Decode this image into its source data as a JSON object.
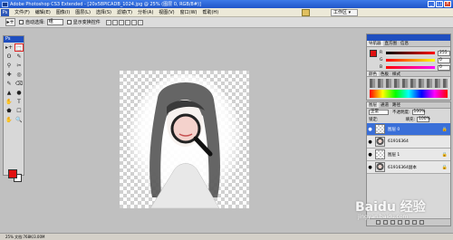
{
  "window": {
    "title": "Adobe Photoshop CS3 Extended - [20x58PICADB_1024.jpg @ 25% (图层 0, RGB/8#)]",
    "minimize": "_",
    "maximize": "□",
    "close": "×"
  },
  "menu": {
    "logo": "Ps",
    "items": [
      "文件(F)",
      "编辑(E)",
      "图像(I)",
      "图层(L)",
      "选择(S)",
      "滤镜(T)",
      "分析(A)",
      "视图(V)",
      "窗口(W)",
      "帮助(H)"
    ],
    "workspace": "工作区 ▾"
  },
  "options": {
    "tool_icon": "▸+",
    "auto_select_label": "自动选择:",
    "auto_select_value": "组",
    "show_transform_label": "显示变换控件"
  },
  "toolbox": {
    "header": "Ps",
    "tools": [
      "▸+",
      "⬚",
      "ʘ",
      "✎",
      "⚲",
      "✂",
      "✚",
      "◎",
      "✎",
      "⌫",
      "▲",
      "●",
      "✋",
      "T",
      "⬟",
      "☐",
      "✋",
      "🔍"
    ]
  },
  "panels": {
    "color": {
      "tabs": [
        "导航器",
        "直方图",
        "信息"
      ],
      "color_tabs": [
        "颜色",
        "色板",
        "样式"
      ],
      "channels": [
        {
          "label": "R",
          "value": "255"
        },
        {
          "label": "G",
          "value": "0"
        },
        {
          "label": "B",
          "value": "0"
        }
      ],
      "fg_color": "#e01010"
    },
    "layers": {
      "tabs": [
        "图层",
        "通道",
        "路径"
      ],
      "blend_mode": "正常",
      "opacity_label": "不透明度:",
      "opacity_value": "100%",
      "lock_label": "锁定:",
      "fill_label": "填充:",
      "fill_value": "100%",
      "rows": [
        {
          "name": "图层 0",
          "thumb": "checker",
          "lock": "🔒"
        },
        {
          "name": "61916364",
          "thumb": "photo",
          "lock": ""
        },
        {
          "name": "图层 1",
          "thumb": "checker",
          "lock": "🔒"
        },
        {
          "name": "61916364副本",
          "thumb": "photo",
          "lock": "🔒"
        }
      ]
    }
  },
  "status": {
    "text": "25%    文档:768K/3.00M"
  },
  "watermark": {
    "main": "Baidu 经验",
    "sub": "jingyan.baidu.com"
  }
}
